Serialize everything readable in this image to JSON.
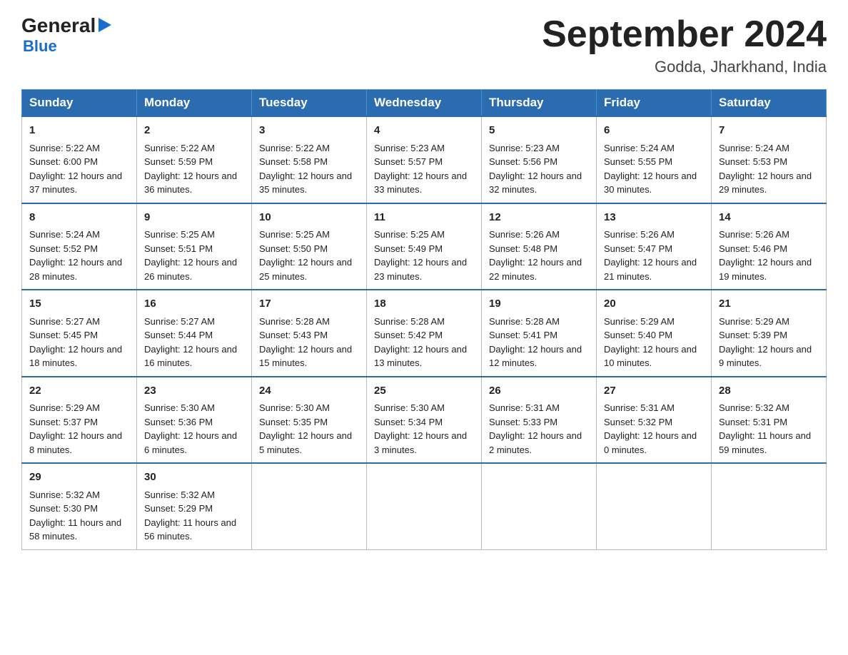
{
  "header": {
    "logo": {
      "general": "General",
      "blue": "Blue",
      "tagline": "Blue"
    },
    "title": "September 2024",
    "location": "Godda, Jharkhand, India"
  },
  "calendar": {
    "days_of_week": [
      "Sunday",
      "Monday",
      "Tuesday",
      "Wednesday",
      "Thursday",
      "Friday",
      "Saturday"
    ],
    "weeks": [
      [
        {
          "day": "1",
          "sunrise": "5:22 AM",
          "sunset": "6:00 PM",
          "daylight": "12 hours and 37 minutes."
        },
        {
          "day": "2",
          "sunrise": "5:22 AM",
          "sunset": "5:59 PM",
          "daylight": "12 hours and 36 minutes."
        },
        {
          "day": "3",
          "sunrise": "5:22 AM",
          "sunset": "5:58 PM",
          "daylight": "12 hours and 35 minutes."
        },
        {
          "day": "4",
          "sunrise": "5:23 AM",
          "sunset": "5:57 PM",
          "daylight": "12 hours and 33 minutes."
        },
        {
          "day": "5",
          "sunrise": "5:23 AM",
          "sunset": "5:56 PM",
          "daylight": "12 hours and 32 minutes."
        },
        {
          "day": "6",
          "sunrise": "5:24 AM",
          "sunset": "5:55 PM",
          "daylight": "12 hours and 30 minutes."
        },
        {
          "day": "7",
          "sunrise": "5:24 AM",
          "sunset": "5:53 PM",
          "daylight": "12 hours and 29 minutes."
        }
      ],
      [
        {
          "day": "8",
          "sunrise": "5:24 AM",
          "sunset": "5:52 PM",
          "daylight": "12 hours and 28 minutes."
        },
        {
          "day": "9",
          "sunrise": "5:25 AM",
          "sunset": "5:51 PM",
          "daylight": "12 hours and 26 minutes."
        },
        {
          "day": "10",
          "sunrise": "5:25 AM",
          "sunset": "5:50 PM",
          "daylight": "12 hours and 25 minutes."
        },
        {
          "day": "11",
          "sunrise": "5:25 AM",
          "sunset": "5:49 PM",
          "daylight": "12 hours and 23 minutes."
        },
        {
          "day": "12",
          "sunrise": "5:26 AM",
          "sunset": "5:48 PM",
          "daylight": "12 hours and 22 minutes."
        },
        {
          "day": "13",
          "sunrise": "5:26 AM",
          "sunset": "5:47 PM",
          "daylight": "12 hours and 21 minutes."
        },
        {
          "day": "14",
          "sunrise": "5:26 AM",
          "sunset": "5:46 PM",
          "daylight": "12 hours and 19 minutes."
        }
      ],
      [
        {
          "day": "15",
          "sunrise": "5:27 AM",
          "sunset": "5:45 PM",
          "daylight": "12 hours and 18 minutes."
        },
        {
          "day": "16",
          "sunrise": "5:27 AM",
          "sunset": "5:44 PM",
          "daylight": "12 hours and 16 minutes."
        },
        {
          "day": "17",
          "sunrise": "5:28 AM",
          "sunset": "5:43 PM",
          "daylight": "12 hours and 15 minutes."
        },
        {
          "day": "18",
          "sunrise": "5:28 AM",
          "sunset": "5:42 PM",
          "daylight": "12 hours and 13 minutes."
        },
        {
          "day": "19",
          "sunrise": "5:28 AM",
          "sunset": "5:41 PM",
          "daylight": "12 hours and 12 minutes."
        },
        {
          "day": "20",
          "sunrise": "5:29 AM",
          "sunset": "5:40 PM",
          "daylight": "12 hours and 10 minutes."
        },
        {
          "day": "21",
          "sunrise": "5:29 AM",
          "sunset": "5:39 PM",
          "daylight": "12 hours and 9 minutes."
        }
      ],
      [
        {
          "day": "22",
          "sunrise": "5:29 AM",
          "sunset": "5:37 PM",
          "daylight": "12 hours and 8 minutes."
        },
        {
          "day": "23",
          "sunrise": "5:30 AM",
          "sunset": "5:36 PM",
          "daylight": "12 hours and 6 minutes."
        },
        {
          "day": "24",
          "sunrise": "5:30 AM",
          "sunset": "5:35 PM",
          "daylight": "12 hours and 5 minutes."
        },
        {
          "day": "25",
          "sunrise": "5:30 AM",
          "sunset": "5:34 PM",
          "daylight": "12 hours and 3 minutes."
        },
        {
          "day": "26",
          "sunrise": "5:31 AM",
          "sunset": "5:33 PM",
          "daylight": "12 hours and 2 minutes."
        },
        {
          "day": "27",
          "sunrise": "5:31 AM",
          "sunset": "5:32 PM",
          "daylight": "12 hours and 0 minutes."
        },
        {
          "day": "28",
          "sunrise": "5:32 AM",
          "sunset": "5:31 PM",
          "daylight": "11 hours and 59 minutes."
        }
      ],
      [
        {
          "day": "29",
          "sunrise": "5:32 AM",
          "sunset": "5:30 PM",
          "daylight": "11 hours and 58 minutes."
        },
        {
          "day": "30",
          "sunrise": "5:32 AM",
          "sunset": "5:29 PM",
          "daylight": "11 hours and 56 minutes."
        },
        {
          "day": "",
          "sunrise": "",
          "sunset": "",
          "daylight": ""
        },
        {
          "day": "",
          "sunrise": "",
          "sunset": "",
          "daylight": ""
        },
        {
          "day": "",
          "sunrise": "",
          "sunset": "",
          "daylight": ""
        },
        {
          "day": "",
          "sunrise": "",
          "sunset": "",
          "daylight": ""
        },
        {
          "day": "",
          "sunrise": "",
          "sunset": "",
          "daylight": ""
        }
      ]
    ]
  }
}
